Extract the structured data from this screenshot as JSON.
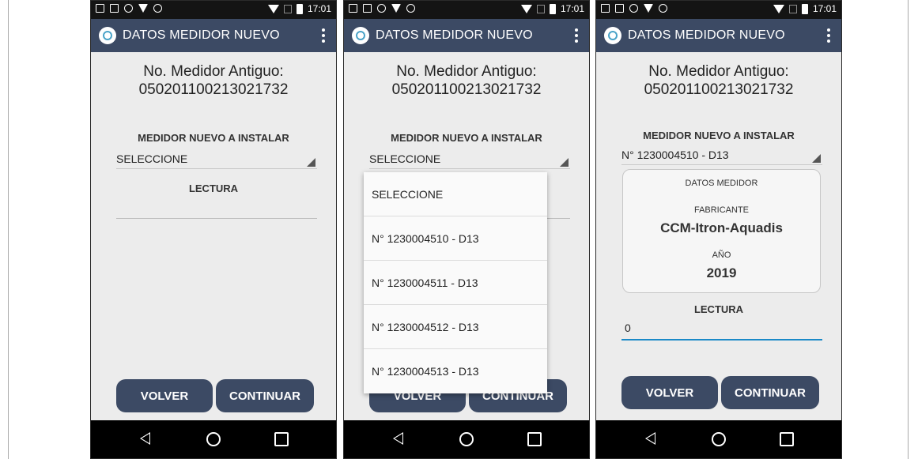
{
  "status_bar": {
    "time": "17:01"
  },
  "app_bar": {
    "title": "DATOS MEDIDOR NUEVO"
  },
  "old_meter": {
    "label": "No. Medidor Antiguo:",
    "value": "050201100213021732"
  },
  "new_meter_section": {
    "label": "MEDIDOR NUEVO A INSTALAR"
  },
  "reading": {
    "label": "LECTURA"
  },
  "screens": [
    {
      "select_value": "SELECCIONE",
      "reading_value": ""
    },
    {
      "select_value": "SELECCIONE",
      "dropdown_options": [
        "SELECCIONE",
        "N° 1230004510 - D13",
        "N° 1230004511 - D13",
        "N° 1230004512 - D13",
        "N° 1230004513 - D13"
      ]
    },
    {
      "select_value": "N° 1230004510 - D13",
      "reading_value": "0",
      "meter_card": {
        "header": "DATOS MEDIDOR",
        "manufacturer_label": "FABRICANTE",
        "manufacturer_value": "CCM-Itron-Aquadis",
        "year_label": "AÑO",
        "year_value": "2019"
      }
    }
  ],
  "buttons": {
    "back": "VOLVER",
    "continue": "CONTINUAR"
  }
}
